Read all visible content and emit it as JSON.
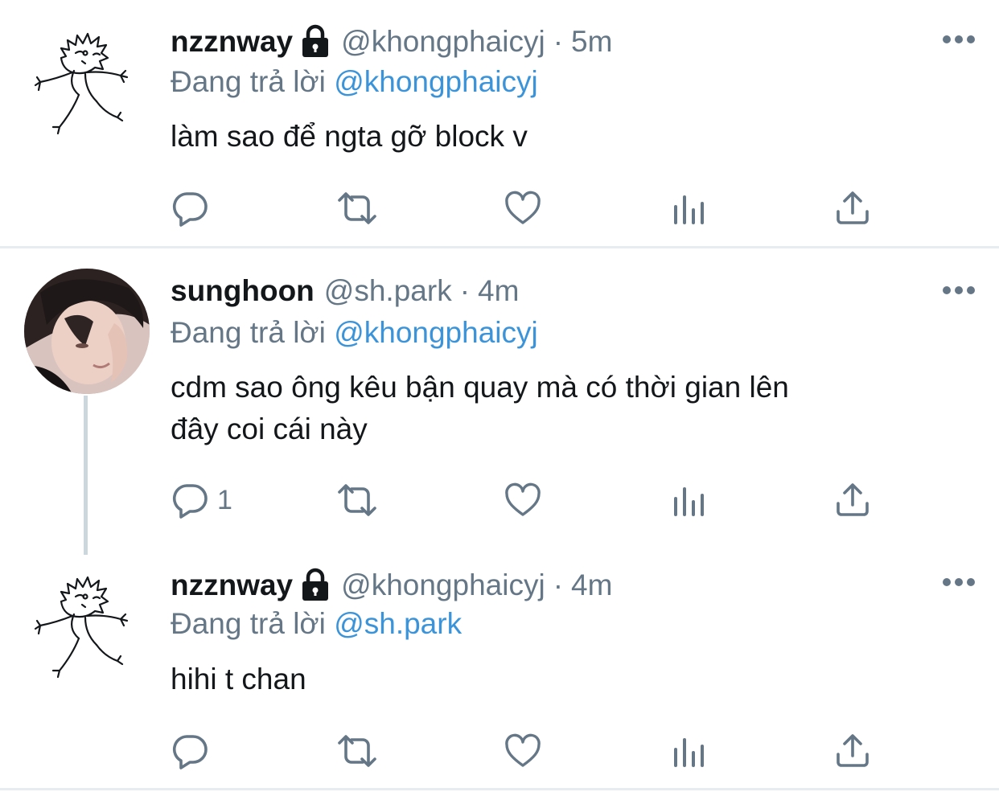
{
  "tweets": [
    {
      "name": "nzznway",
      "locked": true,
      "handle": "@khongphaicyj",
      "separator": "·",
      "time": "5m",
      "replying_prefix": "Đang trả lời",
      "replying_to": "@khongphaicyj",
      "text": "làm sao để ngta gỡ block v",
      "reply_count": "",
      "avatar": "sketch-drawing"
    },
    {
      "name": "sunghoon",
      "locked": false,
      "handle": "@sh.park",
      "separator": "·",
      "time": "4m",
      "replying_prefix": "Đang trả lời",
      "replying_to": "@khongphaicyj",
      "text_line1": "cdm sao ông kêu bận quay mà có thời gian lên",
      "text_line2": "đây coi cái này",
      "reply_count": "1",
      "avatar": "photo"
    },
    {
      "name": "nzznway",
      "locked": true,
      "handle": "@khongphaicyj",
      "separator": "·",
      "time": "4m",
      "replying_prefix": "Đang trả lời",
      "replying_to": "@sh.park",
      "text": "hihi t chan",
      "reply_count": "",
      "avatar": "sketch-drawing"
    }
  ],
  "icons": {
    "reply": "speech-bubble-icon",
    "retweet": "retweet-icon",
    "like": "heart-icon",
    "analytics": "bar-chart-icon",
    "share": "share-upload-icon",
    "more": "ellipsis-icon",
    "lock": "lock-icon"
  },
  "colors": {
    "name": "#14171a",
    "secondary": "#657786",
    "mention": "#3b94d9",
    "divider": "#e6ecf0",
    "thread_line": "#ccd6dd"
  }
}
